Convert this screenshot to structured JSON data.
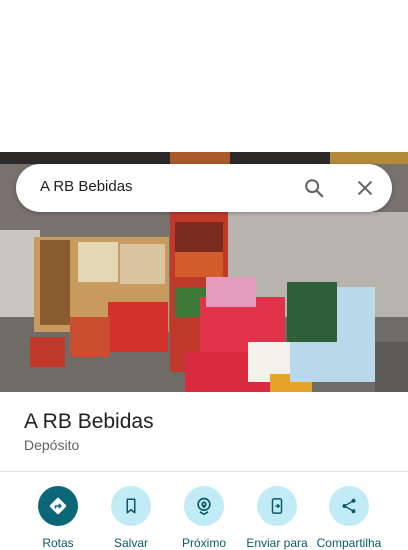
{
  "search": {
    "query": "A RB Bebidas"
  },
  "place": {
    "name": "A RB Bebidas",
    "category": "Depósito"
  },
  "actions": [
    {
      "label": "Rotas",
      "icon": "directions-icon",
      "primary": true
    },
    {
      "label": "Salvar",
      "icon": "bookmark-icon",
      "primary": false
    },
    {
      "label": "Próximo",
      "icon": "nearby-icon",
      "primary": false
    },
    {
      "label": "Enviar para",
      "icon": "send-to-phone-icon",
      "primary": false
    },
    {
      "label": "Compartilha",
      "icon": "share-icon",
      "primary": false
    }
  ],
  "colors": {
    "accent": "#0b6778",
    "accent_light": "#c2ecf5",
    "label": "#0b5966"
  }
}
